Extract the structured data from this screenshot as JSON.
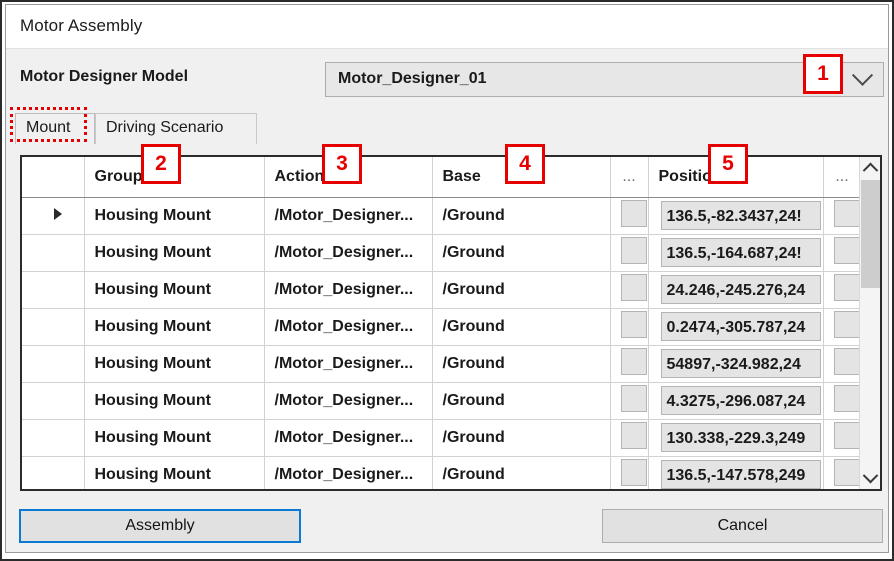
{
  "window": {
    "title": "Motor Assembly"
  },
  "model_row": {
    "label": "Motor Designer Model",
    "combo_value": "Motor_Designer_01",
    "chevron_icon": "chevron-down-icon"
  },
  "tabs": [
    {
      "label": "Mount",
      "active": true
    },
    {
      "label": "Driving Scenario",
      "active": false
    }
  ],
  "grid": {
    "headers": [
      "",
      "Group",
      "Action",
      "Base",
      "...",
      "Position",
      "..."
    ],
    "rows": [
      {
        "selector": "▶",
        "group": "Housing Mount",
        "action": "/Motor_Designer...",
        "base": "/Ground",
        "dots1": "",
        "position": "136.5,-82.3437,24!",
        "dots2": "",
        "selected": true
      },
      {
        "selector": "",
        "group": "Housing Mount",
        "action": "/Motor_Designer...",
        "base": "/Ground",
        "dots1": "",
        "position": "136.5,-164.687,24!",
        "dots2": "",
        "selected": false
      },
      {
        "selector": "",
        "group": "Housing Mount",
        "action": "/Motor_Designer...",
        "base": "/Ground",
        "dots1": "",
        "position": "24.246,-245.276,24",
        "dots2": "",
        "selected": false
      },
      {
        "selector": "",
        "group": "Housing Mount",
        "action": "/Motor_Designer...",
        "base": "/Ground",
        "dots1": "",
        "position": "0.2474,-305.787,24",
        "dots2": "",
        "selected": false
      },
      {
        "selector": "",
        "group": "Housing Mount",
        "action": "/Motor_Designer...",
        "base": "/Ground",
        "dots1": "",
        "position": "54897,-324.982,24",
        "dots2": "",
        "selected": false
      },
      {
        "selector": "",
        "group": "Housing Mount",
        "action": "/Motor_Designer...",
        "base": "/Ground",
        "dots1": "",
        "position": "4.3275,-296.087,24",
        "dots2": "",
        "selected": false
      },
      {
        "selector": "",
        "group": "Housing Mount",
        "action": "/Motor_Designer...",
        "base": "/Ground",
        "dots1": "",
        "position": "130.338,-229.3,249",
        "dots2": "",
        "selected": false
      },
      {
        "selector": "",
        "group": "Housing Mount",
        "action": "/Motor_Designer...",
        "base": "/Ground",
        "dots1": "",
        "position": "136.5,-147.578,249",
        "dots2": "",
        "selected": false
      }
    ],
    "scrollbar": {
      "up_icon": "chevron-up-icon",
      "down_icon": "chevron-down-icon"
    }
  },
  "footer": {
    "assembly_label": "Assembly",
    "cancel_label": "Cancel"
  },
  "annotations": {
    "badges": [
      "1",
      "2",
      "3",
      "4",
      "5"
    ]
  },
  "colors": {
    "selection_blue": "#1e90e0",
    "annotation_red": "#e60000",
    "focus_blue": "#0a7ad4"
  }
}
